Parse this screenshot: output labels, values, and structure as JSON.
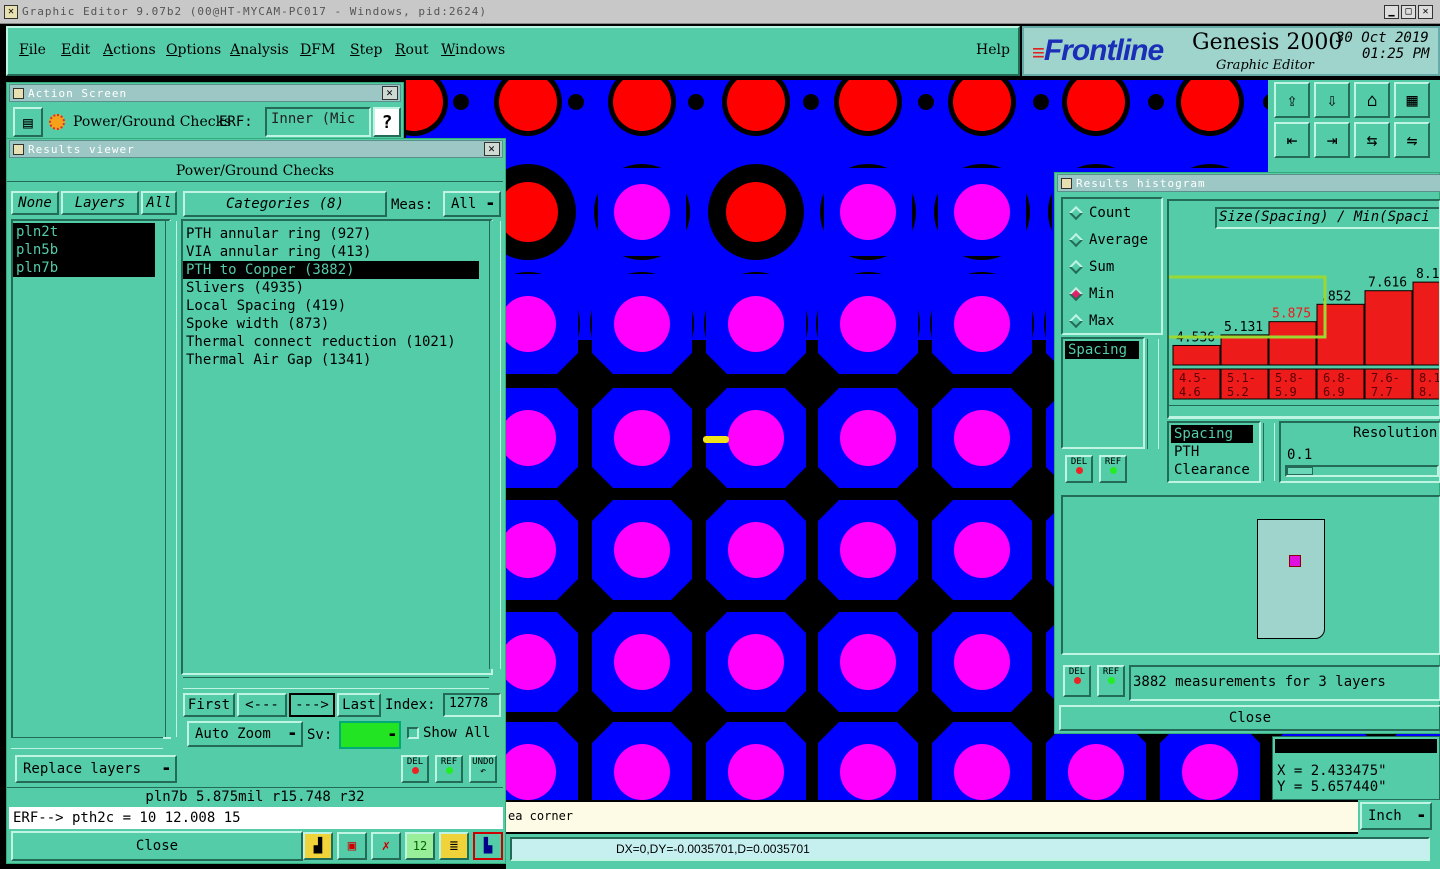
{
  "window": {
    "title": "Graphic Editor 9.07b2 (00@HT-MYCAM-PC017 - Windows, pid:2624)"
  },
  "menu": {
    "items": [
      "File",
      "Edit",
      "Actions",
      "Options",
      "Analysis",
      "DFM",
      "Step",
      "Rout",
      "Windows"
    ],
    "help": "Help"
  },
  "brand": {
    "logo": "Frontline",
    "product": "Genesis 2000",
    "subtitle": "Graphic Editor",
    "date": "30 Oct 2019",
    "time": "01:25 PM"
  },
  "action_screen": {
    "title": "Action Screen",
    "label": "Power/Ground Checks",
    "erf_label": "ERF:",
    "erf_value": "Inner (Mic",
    "help_icon": "?"
  },
  "results_viewer": {
    "title": "Results viewer",
    "header": "Power/Ground Checks",
    "none_btn": "None",
    "layers_btn": "Layers",
    "all_btn": "All",
    "layers": [
      "pln2t",
      "pln5b",
      "pln7b"
    ],
    "categories_label": "Categories (8)",
    "meas_label": "Meas:",
    "meas_value": "All",
    "categories": [
      "PTH annular ring (927)",
      "VIA annular ring (413)",
      "PTH to Copper (3882)",
      "Slivers (4935)",
      "Local Spacing (419)",
      "Spoke width (873)",
      "Thermal connect reduction (1021)",
      "Thermal Air Gap (1341)"
    ],
    "selected_category": 2,
    "first_btn": "First",
    "prev_btn": "<---",
    "next_btn": "--->",
    "last_btn": "Last",
    "index_label": "Index:",
    "index_value": "12778",
    "auto_zoom": "Auto Zoom",
    "sv_label": "Sv:",
    "show_all": "Show All",
    "replace_layers": "Replace layers",
    "del": "DEL",
    "ref": "REF",
    "undo": "UNDO",
    "status_line": "pln7b 5.875mil  r15.748  r32",
    "erf_line": "ERF--> pth2c = 10 12.008 15",
    "close": "Close"
  },
  "histogram": {
    "title": "Results histogram",
    "modes": [
      "Count",
      "Average",
      "Sum",
      "Min",
      "Max"
    ],
    "selected_mode": "Min",
    "chart_title": "Size(Spacing) / Min(Spaci",
    "bar_values": [
      "4.536",
      "5.131",
      "5.875",
      ".852",
      "7.616",
      "8.1"
    ],
    "bar_ranges": [
      "4.5-\n4.6",
      "5.1-\n5.2",
      "5.8-\n5.9",
      "6.8-\n6.9",
      "7.6-\n7.7",
      "8.1\n8."
    ],
    "measure_list": [
      "Spacing"
    ],
    "type_list": [
      "Spacing",
      "PTH",
      "Clearance"
    ],
    "resolution_label": "Resolution",
    "resolution_value": "0.1",
    "summary": "3882 measurements for 3 layers",
    "close": "Close",
    "del": "DEL",
    "ref": "REF"
  },
  "chart_data": {
    "type": "bar",
    "title": "Size(Spacing) / Min(Spaci",
    "categories": [
      "4.5-4.6",
      "5.1-5.2",
      "5.8-5.9",
      "6.8-6.9",
      "7.6-7.7",
      "8.1-8."
    ],
    "values": [
      4.536,
      5.131,
      5.875,
      6.852,
      7.616,
      8.1
    ],
    "highlight_indices": [
      0,
      1,
      2
    ]
  },
  "coords": {
    "x": "X = 2.433475\"",
    "y": "Y = 5.657440\""
  },
  "bottom": {
    "hint": "ea corner",
    "unit": "Inch",
    "delta": "DX=0,DY=-0.0035701,D=0.0035701"
  },
  "colors": {
    "panel": "#54cca8",
    "copper": "#0000ff",
    "pad": "#ff00ff",
    "drill": "#ff0000",
    "highlight": "#9cd832"
  }
}
